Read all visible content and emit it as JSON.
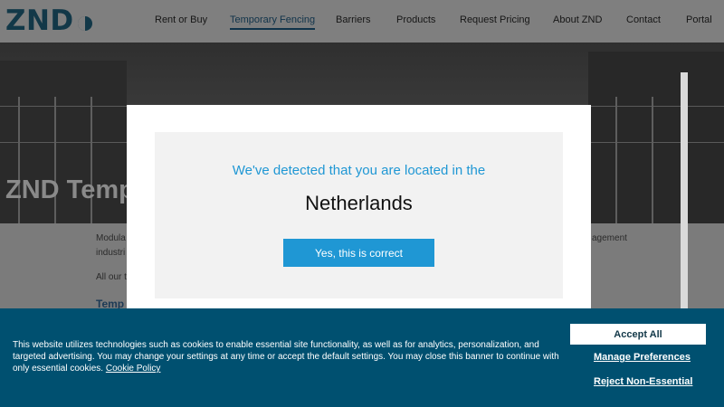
{
  "header": {
    "logo_text": "ZND",
    "nav": [
      {
        "label": "Rent or Buy"
      },
      {
        "label": "Temporary Fencing"
      },
      {
        "label": "Barriers"
      },
      {
        "label": "Products"
      },
      {
        "label": "Request Pricing"
      },
      {
        "label": "About ZND"
      },
      {
        "label": "Contact"
      },
      {
        "label": "Portal"
      }
    ]
  },
  "hero": {
    "title": "ZND Temp"
  },
  "content": {
    "para1_start": "Modula",
    "para1_end": "agement",
    "para1_line2": "industri",
    "para2": "All our t",
    "heading": "Temp"
  },
  "modal": {
    "line1": "We've detected that you are located in the",
    "country": "Netherlands",
    "confirm_button": "Yes, this is correct"
  },
  "cookie": {
    "text": "This website utilizes technologies such as cookies to enable essential site functionality, as well as for analytics, personalization, and targeted advertising. You may change your settings at any time or accept the default settings. You may close this banner to continue with only essential cookies.",
    "policy_link": "Cookie Policy",
    "accept_all": "Accept All",
    "manage_preferences": "Manage Preferences",
    "reject_non_essential": "Reject Non-Essential"
  }
}
